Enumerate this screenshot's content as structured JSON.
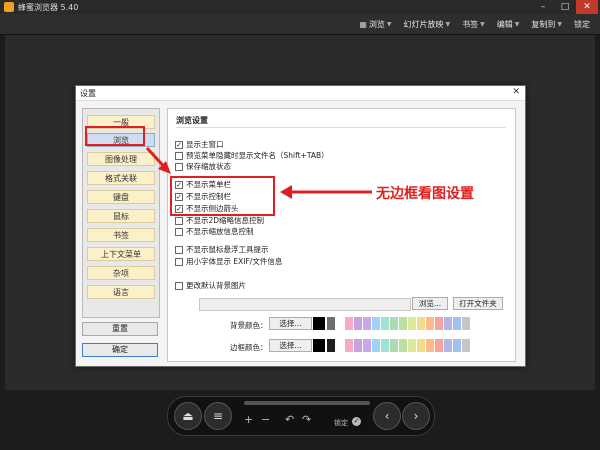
{
  "app": {
    "title": "蜂蜜浏览器 5.40"
  },
  "toolbar": {
    "items": [
      {
        "label": "浏览",
        "icon": "grid-icon"
      },
      {
        "label": "幻灯片放映",
        "icon": ""
      },
      {
        "label": "书签",
        "icon": ""
      },
      {
        "label": "编辑",
        "icon": ""
      },
      {
        "label": "复制到",
        "icon": ""
      },
      {
        "label": "锁定",
        "icon": ""
      }
    ]
  },
  "dialog": {
    "title": "设置",
    "categories": [
      "一般",
      "浏览",
      "图像处理",
      "格式关联",
      "键盘",
      "鼠标",
      "书签",
      "上下文菜单",
      "杂项",
      "语言"
    ],
    "active_category": "浏览",
    "section_title": "浏览设置",
    "options": [
      {
        "label": "显示主窗口",
        "checked": true
      },
      {
        "label": "预览菜单隐藏时显示文件名（Shift+TAB）",
        "checked": false
      },
      {
        "label": "保存缩放状态",
        "checked": false
      },
      {
        "label": "不显示菜单栏",
        "checked": true
      },
      {
        "label": "不显示控制栏",
        "checked": true
      },
      {
        "label": "不显示侧边箭头",
        "checked": true
      },
      {
        "label": "不显示2D缩略信息控制",
        "checked": false
      },
      {
        "label": "不显示缩放信息控制",
        "checked": false
      },
      {
        "label": "不显示鼠标悬浮工具提示",
        "checked": false
      },
      {
        "label": "用小字体显示 EXIF/文件信息",
        "checked": false
      },
      {
        "label": "更改默认背景图片",
        "checked": false
      }
    ],
    "browse_button": "浏览...",
    "open_folder_button": "打开文件夹",
    "bg_color_label": "背景颜色：",
    "border_color_label": "边框颜色：",
    "choose_button": "选择...",
    "palette": [
      "#6e6e6e",
      "#ffffff",
      "#f9a9c4",
      "#c8a2e0",
      "#c8a8e8",
      "#9fd3f5",
      "#9ee3d4",
      "#a9ddb0",
      "#b9e0a0",
      "#dce89a",
      "#f4dd8a",
      "#ffb98a",
      "#f7a29a",
      "#b5b5e6",
      "#9fc2ef",
      "#c6c6c6"
    ],
    "border_palette": [
      "#1e1e1e",
      "#ffffff",
      "#f9a9c4",
      "#c8a2e0",
      "#c8a8e8",
      "#9fd3f5",
      "#9ee3d4",
      "#a9ddb0",
      "#b9e0a0",
      "#dce89a",
      "#f4dd8a",
      "#ffb98a",
      "#f7a29a",
      "#b5b5e6",
      "#9fc2ef",
      "#c6c6c6"
    ],
    "reset_button": "重置",
    "ok_button": "确定"
  },
  "annotation": {
    "text": "无边框看图设置",
    "color": "#e02020"
  },
  "controls": {
    "lock_label": "锁定"
  }
}
